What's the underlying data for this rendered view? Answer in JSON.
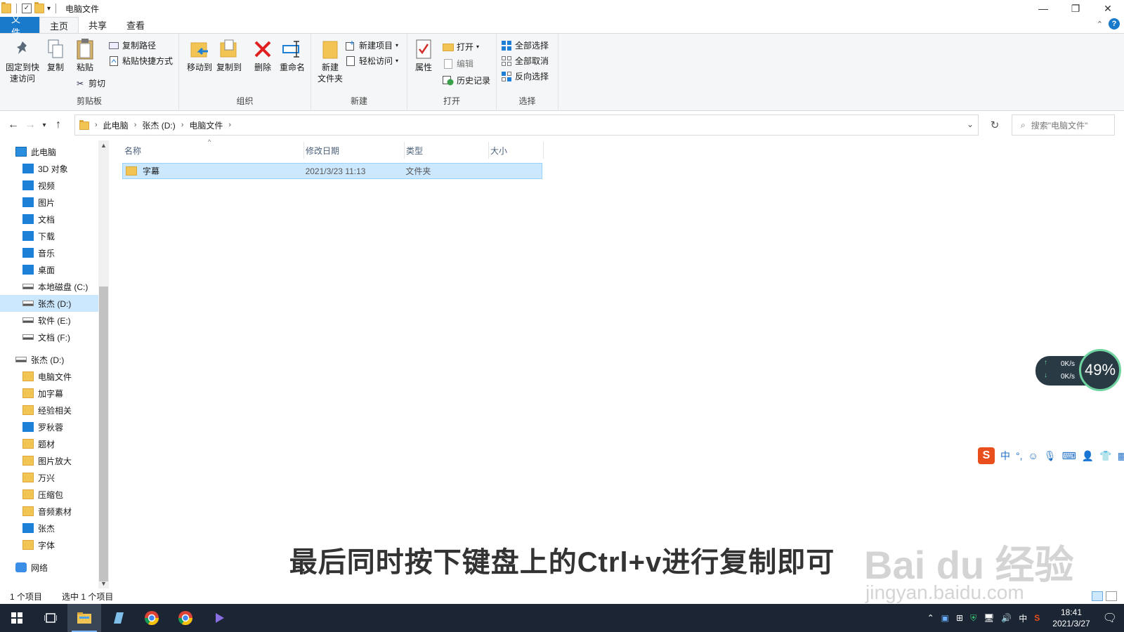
{
  "window": {
    "title": "电脑文件",
    "controls": [
      "—",
      "❐",
      "✕"
    ]
  },
  "ribbon_tabs": [
    "文件",
    "主页",
    "共享",
    "查看"
  ],
  "ribbon": {
    "clipboard": {
      "label": "剪贴板",
      "pin": "固定到快\n速访问",
      "copy": "复制",
      "paste": "粘贴",
      "copy_path": "复制路径",
      "paste_shortcut": "粘贴快捷方式",
      "cut": "剪切"
    },
    "organize": {
      "label": "组织",
      "move_to": "移动到",
      "copy_to": "复制到",
      "delete": "删除",
      "rename": "重命名"
    },
    "new": {
      "label": "新建",
      "new_folder": "新建\n文件夹",
      "new_item": "新建项目",
      "easy_access": "轻松访问"
    },
    "open": {
      "label": "打开",
      "properties": "属性",
      "open": "打开",
      "edit": "编辑",
      "history": "历史记录"
    },
    "select": {
      "label": "选择",
      "select_all": "全部选择",
      "select_none": "全部取消",
      "invert": "反向选择"
    }
  },
  "address": {
    "crumbs": [
      "此电脑",
      "张杰 (D:)",
      "电脑文件"
    ],
    "search_placeholder": "搜索\"电脑文件\""
  },
  "nav_pane": [
    {
      "label": "此电脑",
      "icon": "pc",
      "indent": 0
    },
    {
      "label": "3D 对象",
      "icon": "blue",
      "indent": 1
    },
    {
      "label": "视频",
      "icon": "blue",
      "indent": 1
    },
    {
      "label": "图片",
      "icon": "blue",
      "indent": 1
    },
    {
      "label": "文档",
      "icon": "blue",
      "indent": 1
    },
    {
      "label": "下载",
      "icon": "blue",
      "indent": 1
    },
    {
      "label": "音乐",
      "icon": "blue",
      "indent": 1
    },
    {
      "label": "桌面",
      "icon": "blue",
      "indent": 1
    },
    {
      "label": "本地磁盘 (C:)",
      "icon": "drive",
      "indent": 1
    },
    {
      "label": "张杰 (D:)",
      "icon": "drive",
      "indent": 1,
      "selected": true
    },
    {
      "label": "软件 (E:)",
      "icon": "drive",
      "indent": 1
    },
    {
      "label": "文档 (F:)",
      "icon": "drive",
      "indent": 1
    },
    {
      "label": "张杰 (D:)",
      "icon": "drive",
      "indent": 0,
      "gap": true
    },
    {
      "label": "电脑文件",
      "icon": "folder",
      "indent": 1
    },
    {
      "label": "加字幕",
      "icon": "folder",
      "indent": 1
    },
    {
      "label": "经验相关",
      "icon": "folder",
      "indent": 1
    },
    {
      "label": "罗秋蓉",
      "icon": "blue",
      "indent": 1
    },
    {
      "label": "题材",
      "icon": "folder",
      "indent": 1
    },
    {
      "label": "图片放大",
      "icon": "folder",
      "indent": 1
    },
    {
      "label": "万兴",
      "icon": "folder",
      "indent": 1
    },
    {
      "label": "压缩包",
      "icon": "folder",
      "indent": 1
    },
    {
      "label": "音频素材",
      "icon": "folder",
      "indent": 1
    },
    {
      "label": "张杰",
      "icon": "blue",
      "indent": 1
    },
    {
      "label": "字体",
      "icon": "folder",
      "indent": 1
    },
    {
      "label": "网络",
      "icon": "net",
      "indent": 0,
      "gap": true
    }
  ],
  "file_list": {
    "columns": [
      "名称",
      "修改日期",
      "类型",
      "大小"
    ],
    "rows": [
      {
        "name": "字幕",
        "modified": "2021/3/23 11:13",
        "type": "文件夹",
        "size": ""
      }
    ]
  },
  "status": {
    "count": "1 个项目",
    "selected": "选中 1 个项目"
  },
  "net_widget": {
    "up": "0K/s",
    "down": "0K/s",
    "percent": "49%"
  },
  "ime_toolbar": {
    "logo": "S",
    "mode": "中"
  },
  "taskbar": {
    "time": "18:41",
    "date": "2021/3/27",
    "ime": "中"
  },
  "overlay": {
    "subtitle": "最后同时按下键盘上的Ctrl+v进行复制即可",
    "watermark": "Bai du 经验",
    "watermark_url": "jingyan.baidu.com"
  }
}
